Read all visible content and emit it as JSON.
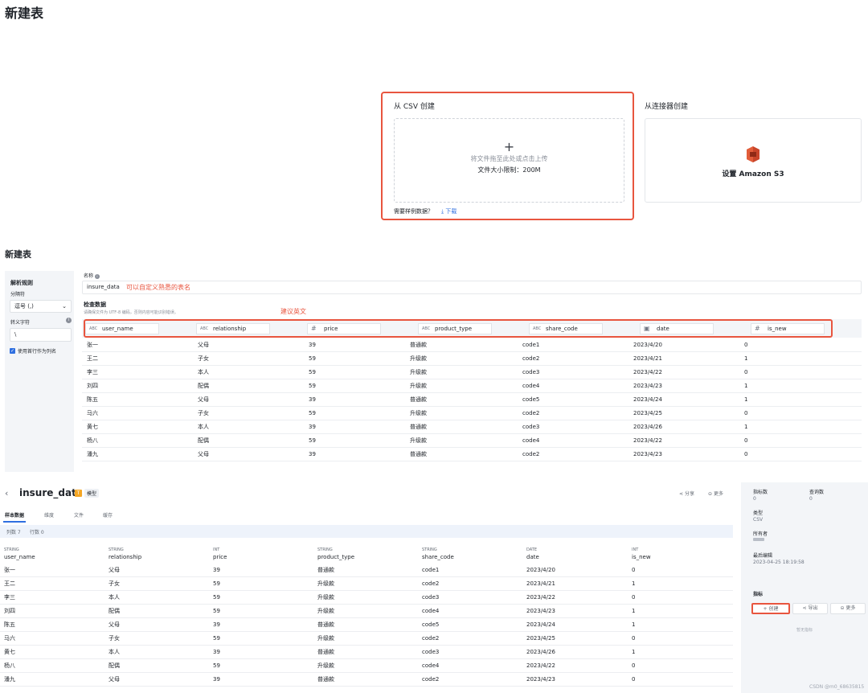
{
  "page_title": "新建表",
  "csv_section": {
    "title": "从 CSV 创建",
    "plus": "+",
    "drop_hint": "将文件拖至此处或点击上传",
    "size_limit": "文件大小限制：200M",
    "sample_text": "需要样例数据？",
    "download_label": "下载"
  },
  "connector_section": {
    "title": "从连接器创建",
    "s3_label": "设置 Amazon S3"
  },
  "editor": {
    "title": "新建表",
    "parse_rules": "解析规则",
    "delimiter_label": "分隔符",
    "delimiter_value": "逗号 (,)",
    "escape_label": "转义字符",
    "escape_value": "\\",
    "header_checkbox_label": "使用首行作为列名",
    "name_label": "名称",
    "name_value": "insure_data",
    "name_note": "可以自定义熟悉的表名",
    "check_title": "检查数据",
    "check_desc": "请确保文件为 UTF-8 编码，否则内容可能识别错误。",
    "english_note": "建议英文",
    "columns": [
      {
        "type": "ABC",
        "name": "user_name"
      },
      {
        "type": "ABC",
        "name": "relationship"
      },
      {
        "type": "#",
        "name": "price"
      },
      {
        "type": "ABC",
        "name": "product_type"
      },
      {
        "type": "ABC",
        "name": "share_code"
      },
      {
        "type": "cal",
        "name": "date"
      },
      {
        "type": "#",
        "name": "is_new"
      }
    ]
  },
  "rows": [
    [
      "张一",
      "父母",
      "39",
      "普通款",
      "code1",
      "2023/4/20",
      "0"
    ],
    [
      "王二",
      "子女",
      "59",
      "升级款",
      "code2",
      "2023/4/21",
      "1"
    ],
    [
      "李三",
      "本人",
      "59",
      "升级款",
      "code3",
      "2023/4/22",
      "0"
    ],
    [
      "刘四",
      "配偶",
      "59",
      "升级款",
      "code4",
      "2023/4/23",
      "1"
    ],
    [
      "陈五",
      "父母",
      "39",
      "普通款",
      "code5",
      "2023/4/24",
      "1"
    ],
    [
      "马六",
      "子女",
      "59",
      "升级款",
      "code2",
      "2023/4/25",
      "0"
    ],
    [
      "黄七",
      "本人",
      "39",
      "普通款",
      "code3",
      "2023/4/26",
      "1"
    ],
    [
      "杨八",
      "配偶",
      "59",
      "升级款",
      "code4",
      "2023/4/22",
      "0"
    ],
    [
      "潘九",
      "父母",
      "39",
      "普通款",
      "code2",
      "2023/4/23",
      "0"
    ]
  ],
  "detail": {
    "back": "‹",
    "title": "insure_data",
    "badge_t": "T",
    "badge_label": "模型",
    "share_label": "分享",
    "more_label": "更多",
    "tabs": [
      "样本数据",
      "维度",
      "文件",
      "缓存"
    ],
    "col_count": "列数 7",
    "row_count": "行数 0",
    "headers": [
      {
        "type": "STRING",
        "name": "user_name"
      },
      {
        "type": "STRING",
        "name": "relationship"
      },
      {
        "type": "INT",
        "name": "price"
      },
      {
        "type": "STRING",
        "name": "product_type"
      },
      {
        "type": "STRING",
        "name": "share_code"
      },
      {
        "type": "DATE",
        "name": "date"
      },
      {
        "type": "INT",
        "name": "is_new"
      }
    ]
  },
  "side": {
    "metrics_count_label": "指标数",
    "metrics_count": "0",
    "query_count_label": "查询数",
    "query_count": "0",
    "type_label": "类型",
    "type_value": "CSV",
    "owner_label": "所有者",
    "last_edit_label": "最后编辑",
    "last_edit_value": "2023-04-25 18:19:58",
    "metrics_label": "指标",
    "create_label": "+ 创建",
    "export_label": "导出",
    "more_label": "更多",
    "empty_label": "暂无指标"
  },
  "watermark": "CSDN @m0_68635815",
  "colors": {
    "accent": "#e8553f",
    "link": "#2f6fe0"
  }
}
